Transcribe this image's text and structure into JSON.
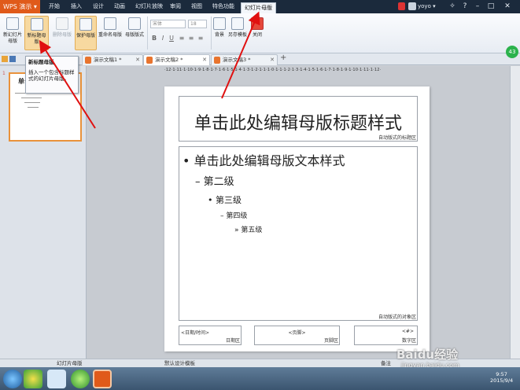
{
  "app": {
    "name": "WPS 演示"
  },
  "menu_tabs": [
    "开始",
    "插入",
    "设计",
    "动画",
    "幻灯片放映",
    "审阅",
    "视图",
    "特色功能"
  ],
  "active_tab": "幻灯片母版",
  "user": {
    "name": "yoyo"
  },
  "ribbon": {
    "new_master": "新幻灯片母版",
    "new_title_master": "新标题母版",
    "delete_master": "删除母版",
    "protect_master": "保护母版",
    "rename_master": "重命名母版",
    "master_layout": "母版版式",
    "font_name": "宋体",
    "font_size": "18",
    "background": "背景",
    "save_as_template": "另存模板",
    "close": "关闭"
  },
  "doc_tabs": [
    "演示文稿1 *",
    "演示文稿2 *",
    "演示文稿3 *"
  ],
  "tooltip": {
    "title": "新标题母版",
    "body": "插入一个包含标题样式的幻灯片母版。"
  },
  "thumbnail": {
    "number": "1",
    "title": "单击"
  },
  "ruler": {
    "text": "·12·1·11·1·10·1·9·1·8·1·7·1·6·1·5·1·4·1·3·1·2·1·1·1·0·1·1·1·2·1·3·1·4·1·5·1·6·1·7·1·8·1·9·1·10·1·11·1·12·"
  },
  "slide": {
    "title": "单击此处编辑母版标题样式",
    "title_tag": "自动版式的标题区",
    "body_tag": "自动版式的对象区",
    "levels": [
      "单击此处编辑母版文本样式",
      "第二级",
      "第三级",
      "第四级",
      "第五级"
    ],
    "footer": [
      {
        "field": "<日期/时间>",
        "label": "日期区"
      },
      {
        "field": "<页脚>",
        "label": "页脚区"
      },
      {
        "field": "<#>",
        "label": "数字区"
      }
    ]
  },
  "status": {
    "left": "幻灯片母版",
    "mid": "默认设计模板",
    "notes": "备注"
  },
  "clock": {
    "time": "9:57",
    "date": "2015/9/4"
  },
  "watermark": {
    "brand": "Baidu经验",
    "url": "jingyan.baidu.com"
  },
  "colors": {
    "titlebar": "#1b2a3c",
    "wps_orange": "#e05a1a",
    "highlight": "#f7d9a0",
    "annotation_arrow": "#e01010"
  }
}
